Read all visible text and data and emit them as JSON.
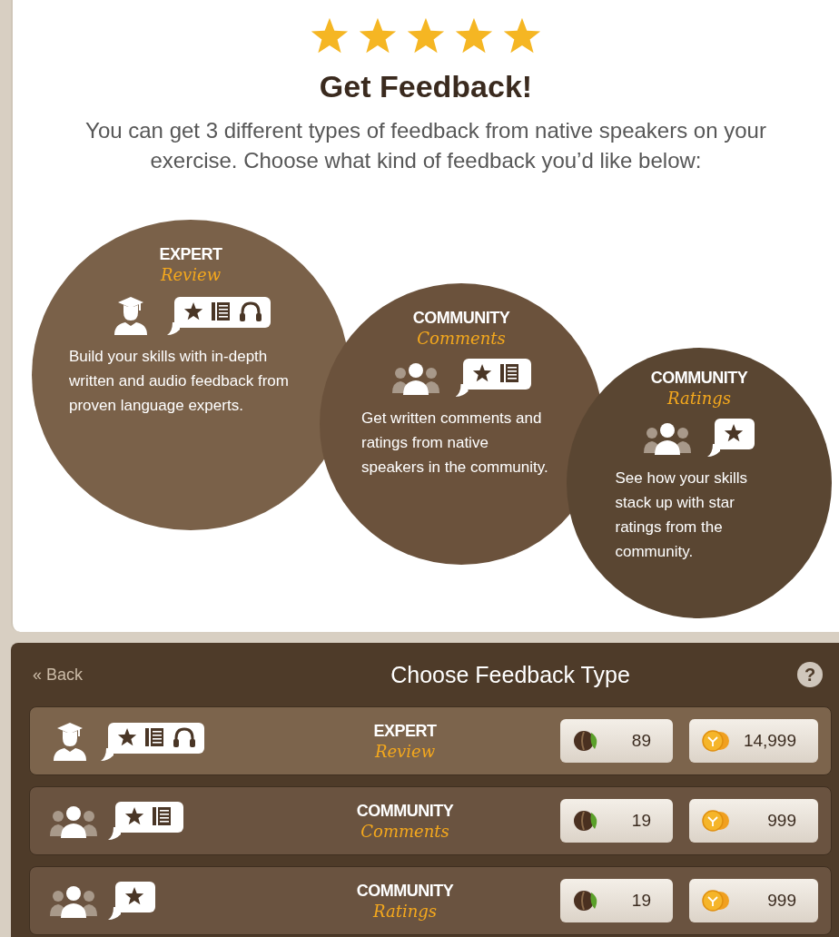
{
  "rating": {
    "stars": 5
  },
  "title": "Get Feedback!",
  "intro": "You can get 3 different types of feedback from native speakers on your exercise. Choose what kind of feedback you’d like below:",
  "types": [
    {
      "kind": "expert",
      "label": "EXPERT",
      "sublabel": "Review",
      "features": {
        "star": true,
        "notes": true,
        "headphones": true
      },
      "description": "Build your skills with in-depth written and audio feedback from proven language experts."
    },
    {
      "kind": "community",
      "label": "COMMUNITY",
      "sublabel": "Comments",
      "features": {
        "star": true,
        "notes": true,
        "headphones": false
      },
      "description": "Get written comments and ratings from native speakers in the community."
    },
    {
      "kind": "community",
      "label": "COMMUNITY",
      "sublabel": "Ratings",
      "features": {
        "star": true,
        "notes": false,
        "headphones": false
      },
      "description": "See how your skills stack up with star ratings from the community."
    }
  ],
  "chooser": {
    "back": "« Back",
    "title": "Choose Feedback Type",
    "help": "?",
    "options": [
      {
        "kind": "expert",
        "label": "EXPERT",
        "sublabel": "Review",
        "features": {
          "star": true,
          "notes": true,
          "headphones": true
        },
        "selected": true,
        "beans": "89",
        "coins": "14,999"
      },
      {
        "kind": "community",
        "label": "COMMUNITY",
        "sublabel": "Comments",
        "features": {
          "star": true,
          "notes": true,
          "headphones": false
        },
        "selected": false,
        "beans": "19",
        "coins": "999"
      },
      {
        "kind": "community",
        "label": "COMMUNITY",
        "sublabel": "Ratings",
        "features": {
          "star": true,
          "notes": false,
          "headphones": false
        },
        "selected": false,
        "beans": "19",
        "coins": "999"
      }
    ]
  }
}
